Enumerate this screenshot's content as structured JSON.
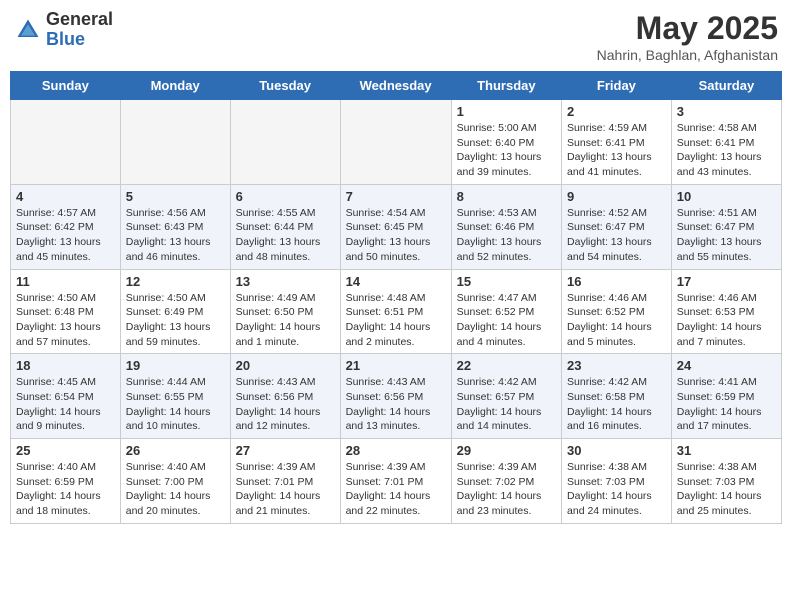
{
  "header": {
    "logo_general": "General",
    "logo_blue": "Blue",
    "month_title": "May 2025",
    "location": "Nahrin, Baghlan, Afghanistan"
  },
  "days_of_week": [
    "Sunday",
    "Monday",
    "Tuesday",
    "Wednesday",
    "Thursday",
    "Friday",
    "Saturday"
  ],
  "weeks": [
    [
      {
        "num": "",
        "info": ""
      },
      {
        "num": "",
        "info": ""
      },
      {
        "num": "",
        "info": ""
      },
      {
        "num": "",
        "info": ""
      },
      {
        "num": "1",
        "info": "Sunrise: 5:00 AM\nSunset: 6:40 PM\nDaylight: 13 hours\nand 39 minutes."
      },
      {
        "num": "2",
        "info": "Sunrise: 4:59 AM\nSunset: 6:41 PM\nDaylight: 13 hours\nand 41 minutes."
      },
      {
        "num": "3",
        "info": "Sunrise: 4:58 AM\nSunset: 6:41 PM\nDaylight: 13 hours\nand 43 minutes."
      }
    ],
    [
      {
        "num": "4",
        "info": "Sunrise: 4:57 AM\nSunset: 6:42 PM\nDaylight: 13 hours\nand 45 minutes."
      },
      {
        "num": "5",
        "info": "Sunrise: 4:56 AM\nSunset: 6:43 PM\nDaylight: 13 hours\nand 46 minutes."
      },
      {
        "num": "6",
        "info": "Sunrise: 4:55 AM\nSunset: 6:44 PM\nDaylight: 13 hours\nand 48 minutes."
      },
      {
        "num": "7",
        "info": "Sunrise: 4:54 AM\nSunset: 6:45 PM\nDaylight: 13 hours\nand 50 minutes."
      },
      {
        "num": "8",
        "info": "Sunrise: 4:53 AM\nSunset: 6:46 PM\nDaylight: 13 hours\nand 52 minutes."
      },
      {
        "num": "9",
        "info": "Sunrise: 4:52 AM\nSunset: 6:47 PM\nDaylight: 13 hours\nand 54 minutes."
      },
      {
        "num": "10",
        "info": "Sunrise: 4:51 AM\nSunset: 6:47 PM\nDaylight: 13 hours\nand 55 minutes."
      }
    ],
    [
      {
        "num": "11",
        "info": "Sunrise: 4:50 AM\nSunset: 6:48 PM\nDaylight: 13 hours\nand 57 minutes."
      },
      {
        "num": "12",
        "info": "Sunrise: 4:50 AM\nSunset: 6:49 PM\nDaylight: 13 hours\nand 59 minutes."
      },
      {
        "num": "13",
        "info": "Sunrise: 4:49 AM\nSunset: 6:50 PM\nDaylight: 14 hours\nand 1 minute."
      },
      {
        "num": "14",
        "info": "Sunrise: 4:48 AM\nSunset: 6:51 PM\nDaylight: 14 hours\nand 2 minutes."
      },
      {
        "num": "15",
        "info": "Sunrise: 4:47 AM\nSunset: 6:52 PM\nDaylight: 14 hours\nand 4 minutes."
      },
      {
        "num": "16",
        "info": "Sunrise: 4:46 AM\nSunset: 6:52 PM\nDaylight: 14 hours\nand 5 minutes."
      },
      {
        "num": "17",
        "info": "Sunrise: 4:46 AM\nSunset: 6:53 PM\nDaylight: 14 hours\nand 7 minutes."
      }
    ],
    [
      {
        "num": "18",
        "info": "Sunrise: 4:45 AM\nSunset: 6:54 PM\nDaylight: 14 hours\nand 9 minutes."
      },
      {
        "num": "19",
        "info": "Sunrise: 4:44 AM\nSunset: 6:55 PM\nDaylight: 14 hours\nand 10 minutes."
      },
      {
        "num": "20",
        "info": "Sunrise: 4:43 AM\nSunset: 6:56 PM\nDaylight: 14 hours\nand 12 minutes."
      },
      {
        "num": "21",
        "info": "Sunrise: 4:43 AM\nSunset: 6:56 PM\nDaylight: 14 hours\nand 13 minutes."
      },
      {
        "num": "22",
        "info": "Sunrise: 4:42 AM\nSunset: 6:57 PM\nDaylight: 14 hours\nand 14 minutes."
      },
      {
        "num": "23",
        "info": "Sunrise: 4:42 AM\nSunset: 6:58 PM\nDaylight: 14 hours\nand 16 minutes."
      },
      {
        "num": "24",
        "info": "Sunrise: 4:41 AM\nSunset: 6:59 PM\nDaylight: 14 hours\nand 17 minutes."
      }
    ],
    [
      {
        "num": "25",
        "info": "Sunrise: 4:40 AM\nSunset: 6:59 PM\nDaylight: 14 hours\nand 18 minutes."
      },
      {
        "num": "26",
        "info": "Sunrise: 4:40 AM\nSunset: 7:00 PM\nDaylight: 14 hours\nand 20 minutes."
      },
      {
        "num": "27",
        "info": "Sunrise: 4:39 AM\nSunset: 7:01 PM\nDaylight: 14 hours\nand 21 minutes."
      },
      {
        "num": "28",
        "info": "Sunrise: 4:39 AM\nSunset: 7:01 PM\nDaylight: 14 hours\nand 22 minutes."
      },
      {
        "num": "29",
        "info": "Sunrise: 4:39 AM\nSunset: 7:02 PM\nDaylight: 14 hours\nand 23 minutes."
      },
      {
        "num": "30",
        "info": "Sunrise: 4:38 AM\nSunset: 7:03 PM\nDaylight: 14 hours\nand 24 minutes."
      },
      {
        "num": "31",
        "info": "Sunrise: 4:38 AM\nSunset: 7:03 PM\nDaylight: 14 hours\nand 25 minutes."
      }
    ]
  ]
}
